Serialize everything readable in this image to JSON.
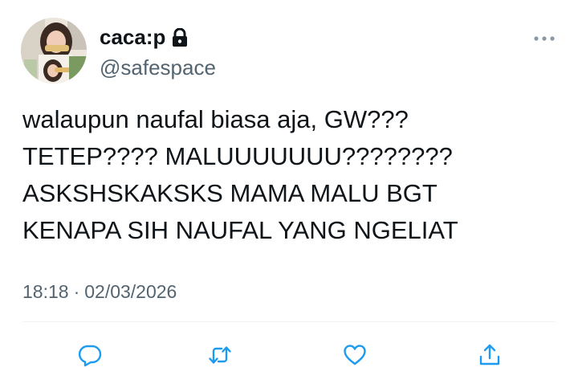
{
  "user": {
    "display_name": "caca:p",
    "handle": "@safespace",
    "protected_icon": "lock-icon",
    "avatar": "avatar-photo"
  },
  "tweet": {
    "lines": [
      "walaupun naufal biasa aja, GW???",
      "TETEP???? MALUUUUUUU????????",
      "ASKSHSKAKSKS MAMA MALU BGT",
      "KENAPA SIH NAUFAL YANG NGELIAT"
    ],
    "time": "18:18",
    "separator": "·",
    "date": "02/03/2026"
  },
  "actions": {
    "reply_icon": "reply-icon",
    "retweet_icon": "retweet-icon",
    "like_icon": "heart-icon",
    "share_icon": "share-icon"
  },
  "colors": {
    "text": "#0f1419",
    "secondary": "#536471",
    "action_icon": "#1d9bf0",
    "divider": "#eff3f4"
  }
}
